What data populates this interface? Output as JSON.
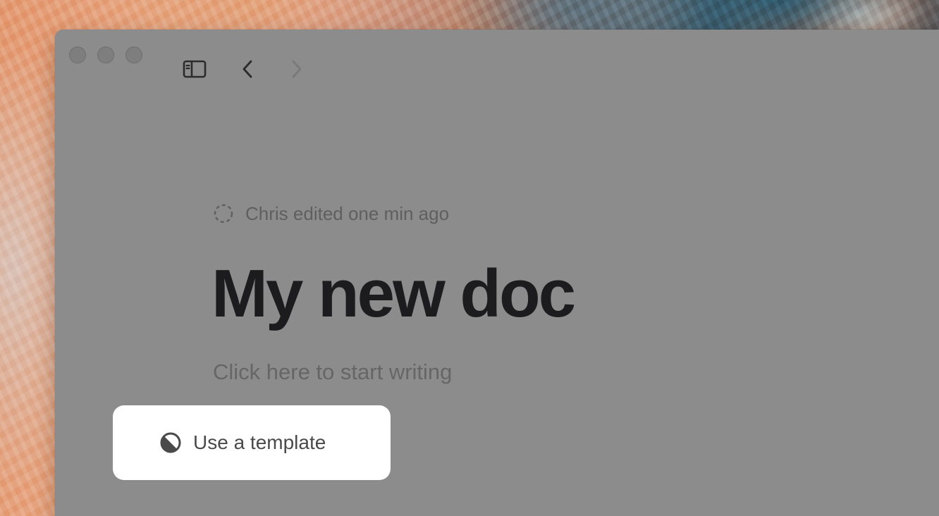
{
  "document": {
    "edited_status": "Chris edited one min ago",
    "title": "My new doc",
    "body_placeholder": "Click here to start writing"
  },
  "actions": {
    "use_template_label": "Use a template"
  },
  "icons": {
    "sidebar": "sidebar-toggle-icon",
    "back": "chevron-left-icon",
    "forward": "chevron-right-icon",
    "edit_status": "dashed-circle-icon",
    "template": "half-circle-icon"
  },
  "colors": {
    "window_background": "#8c8c8c",
    "title_text": "#1c1c1e",
    "template_button": "#ffffff"
  }
}
